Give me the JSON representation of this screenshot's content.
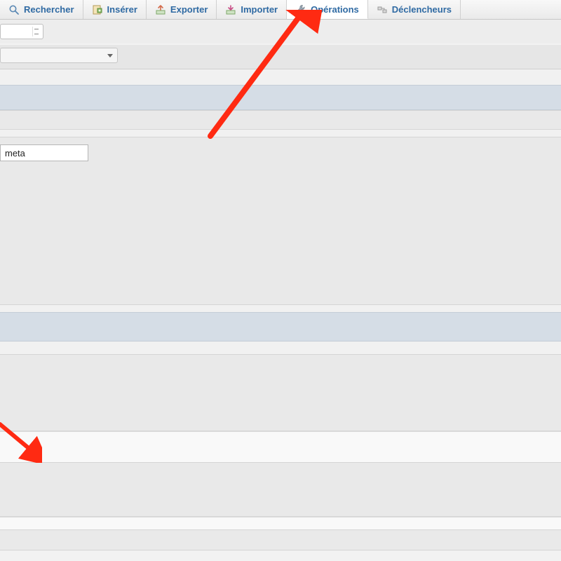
{
  "tabs": [
    {
      "label": "Rechercher",
      "icon": "search-icon"
    },
    {
      "label": "Insérer",
      "icon": "insert-icon"
    },
    {
      "label": "Exporter",
      "icon": "export-icon"
    },
    {
      "label": "Importer",
      "icon": "import-icon"
    },
    {
      "label": "Opérations",
      "icon": "wrench-icon"
    },
    {
      "label": "Déclencheurs",
      "icon": "trigger-icon"
    }
  ],
  "active_tab_index": 4,
  "form": {
    "name_field_value": "meta"
  }
}
